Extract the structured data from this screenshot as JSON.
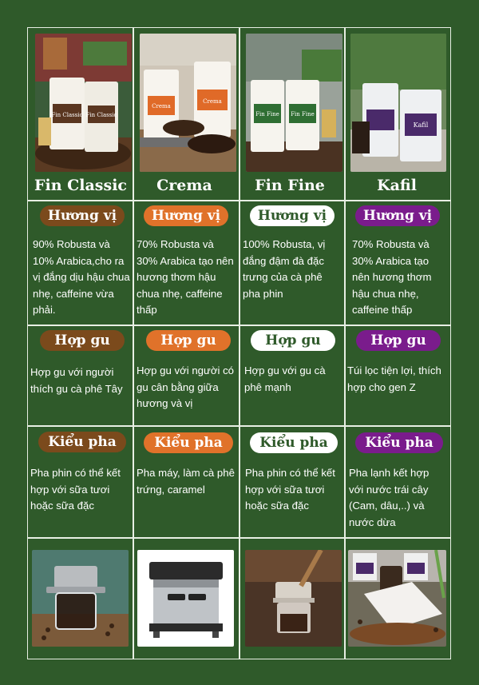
{
  "colors": {
    "background": "#2f5a2a",
    "grid_line": "#e8efe4",
    "text": "#ffffff",
    "pill_brown": "#7b4a1c",
    "pill_orange": "#e0722a",
    "pill_white": "#ffffff",
    "pill_purple": "#7a1c8c"
  },
  "products": [
    {
      "name": "Fin Classic",
      "bag_label": "Fin Classic",
      "pill_style": "brown",
      "taste_label": "Hương vị",
      "taste_text": "90% Robusta và 10% Arabica,cho ra vị đắng dịu hậu chua nhẹ, caffeine vừa phải.",
      "fit_label": "Hợp gu",
      "fit_text": "Hợp  gu với người thích gu cà phê Tây",
      "brew_label": "Kiểu pha",
      "brew_text": "Pha phin có thể kết hợp với sữa tươi hoặc sữa đặc"
    },
    {
      "name": "Crema",
      "bag_label": "Crema",
      "pill_style": "orange",
      "taste_label": "Hương vị",
      "taste_text": "70% Robusta và 30% Arabica tạo nên hương thơm hậu chua nhẹ, caffeine thấp",
      "fit_label": "Hợp gu",
      "fit_text": "Hợp gu với người có gu cân bằng giữa hương và vị",
      "brew_label": "Kiểu pha",
      "brew_text": "Pha máy, làm cà phê trứng, caramel"
    },
    {
      "name": "Fin Fine",
      "bag_label": "Fin Fine",
      "pill_style": "white",
      "taste_label": "Hương vị",
      "taste_text": "100% Robusta, vị đắng đậm đà đặc trưng của cà phê pha phin",
      "fit_label": "Hợp gu",
      "fit_text": "Hợp gu với gu cà phê mạnh",
      "brew_label": "Kiểu pha",
      "brew_text": "Pha phin có thể kết hợp với sữa tươi hoặc sữa đặc"
    },
    {
      "name": "Kafil",
      "bag_label": "Kafil",
      "pill_style": "purple",
      "taste_label": "Hương vị",
      "taste_text": "70% Robusta và 30% Arabica tạo nên hương thơm hậu chua nhẹ, caffeine thấp",
      "fit_label": "Hợp gu",
      "fit_text": "Túi lọc tiện lợi, thích hợp cho gen Z",
      "brew_label": "Kiểu pha",
      "brew_text": "Pha lạnh kết hợp với nước  trái cây (Cam, dâu,..) và nước dừa"
    }
  ]
}
